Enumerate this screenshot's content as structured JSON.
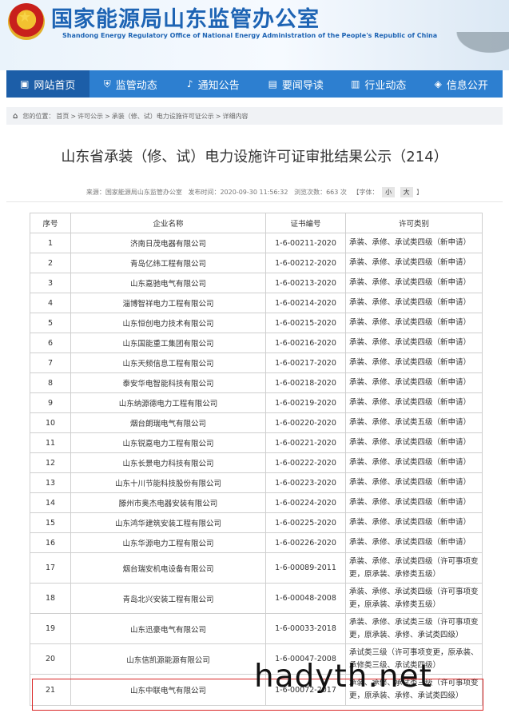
{
  "header": {
    "title_cn": "国家能源局山东监管办公室",
    "title_en": "Shandong Energy Regulatory Office of National Energy Administration of the People's Republic of China"
  },
  "nav": [
    {
      "label": "网站首页",
      "icon": "home-icon"
    },
    {
      "label": "监管动态",
      "icon": "shield-icon"
    },
    {
      "label": "通知公告",
      "icon": "bell-icon"
    },
    {
      "label": "要闻导读",
      "icon": "newspaper-icon"
    },
    {
      "label": "行业动态",
      "icon": "bar-chart-icon"
    },
    {
      "label": "信息公开",
      "icon": "layers-icon"
    }
  ],
  "breadcrumb": {
    "prefix": "您的位置：",
    "items": [
      "首页",
      "许可公示",
      "承装（修、试）电力设施许可证公示",
      "详细内容"
    ],
    "sep": ">"
  },
  "article": {
    "title": "山东省承装（修、试）电力设施许可证审批结果公示（214）",
    "source": "来源：国家能源局山东监管办公室",
    "published": "发布时间：2020-09-30 11:56:32",
    "views": "浏览次数：663 次",
    "font_label": "【字体：",
    "font_small": "小",
    "font_big": "大",
    "font_close": "】"
  },
  "table": {
    "headers": [
      "序号",
      "企业名称",
      "证书编号",
      "许可类别"
    ],
    "rows": [
      [
        "1",
        "济南日茂电器有限公司",
        "1-6-00211-2020",
        "承装、承修、承试类四级（新申请）"
      ],
      [
        "2",
        "青岛亿纬工程有限公司",
        "1-6-00212-2020",
        "承装、承修、承试类四级（新申请）"
      ],
      [
        "3",
        "山东嘉驰电气有限公司",
        "1-6-00213-2020",
        "承装、承修、承试类四级（新申请）"
      ],
      [
        "4",
        "淄博智祥电力工程有限公司",
        "1-6-00214-2020",
        "承装、承修、承试类四级（新申请）"
      ],
      [
        "5",
        "山东恒创电力技术有限公司",
        "1-6-00215-2020",
        "承装、承修、承试类四级（新申请）"
      ],
      [
        "6",
        "山东国能重工集团有限公司",
        "1-6-00216-2020",
        "承装、承修、承试类四级（新申请）"
      ],
      [
        "7",
        "山东天频信息工程有限公司",
        "1-6-00217-2020",
        "承装、承修、承试类四级（新申请）"
      ],
      [
        "8",
        "泰安华电智能科技有限公司",
        "1-6-00218-2020",
        "承装、承修、承试类四级（新申请）"
      ],
      [
        "9",
        "山东纳源德电力工程有限公司",
        "1-6-00219-2020",
        "承装、承修、承试类四级（新申请）"
      ],
      [
        "10",
        "烟台朗瑞电气有限公司",
        "1-6-00220-2020",
        "承装、承修、承试类五级（新申请）"
      ],
      [
        "11",
        "山东锐嘉电力工程有限公司",
        "1-6-00221-2020",
        "承装、承修、承试类四级（新申请）"
      ],
      [
        "12",
        "山东长景电力科技有限公司",
        "1-6-00222-2020",
        "承装、承修、承试类四级（新申请）"
      ],
      [
        "13",
        "山东十川节能科技股份有限公司",
        "1-6-00223-2020",
        "承装、承修、承试类四级（新申请）"
      ],
      [
        "14",
        "滕州市奥杰电器安装有限公司",
        "1-6-00224-2020",
        "承装、承修、承试类四级（新申请）"
      ],
      [
        "15",
        "山东鸿华建筑安装工程有限公司",
        "1-6-00225-2020",
        "承装、承修、承试类四级（新申请）"
      ],
      [
        "16",
        "山东华源电力工程有限公司",
        "1-6-00226-2020",
        "承装、承修、承试类四级（新申请）"
      ],
      [
        "17",
        "烟台瑞安机电设备有限公司",
        "1-6-00089-2011",
        "承装、承修、承试类四级（许可事项变更，原承装、承修类五级）"
      ],
      [
        "18",
        "青岛北兴安装工程有限公司",
        "1-6-00048-2008",
        "承装、承修、承试类四级（许可事项变更，原承装、承修类五级）"
      ],
      [
        "19",
        "山东迅豪电气有限公司",
        "1-6-00033-2018",
        "承装、承修、承试类三级（许可事项变更，原承装、承修、承试类四级）"
      ],
      [
        "20",
        "山东信凯源能源有限公司",
        "1-6-00047-2008",
        "承试类三级（许可事项变更，原承装、承修类三级、承试类四级）"
      ],
      [
        "21",
        "山东中联电气有限公司",
        "1-6-00072-2017",
        "承装、承修、承试类三级（许可事项变更，原承装、承修、承试类四级）"
      ]
    ]
  },
  "watermark": "hadyth.net",
  "colors": {
    "brand": "#1e64b4",
    "nav": "#2d7fd0",
    "nav_active": "#1c5ea8",
    "highlight": "#d92525"
  }
}
